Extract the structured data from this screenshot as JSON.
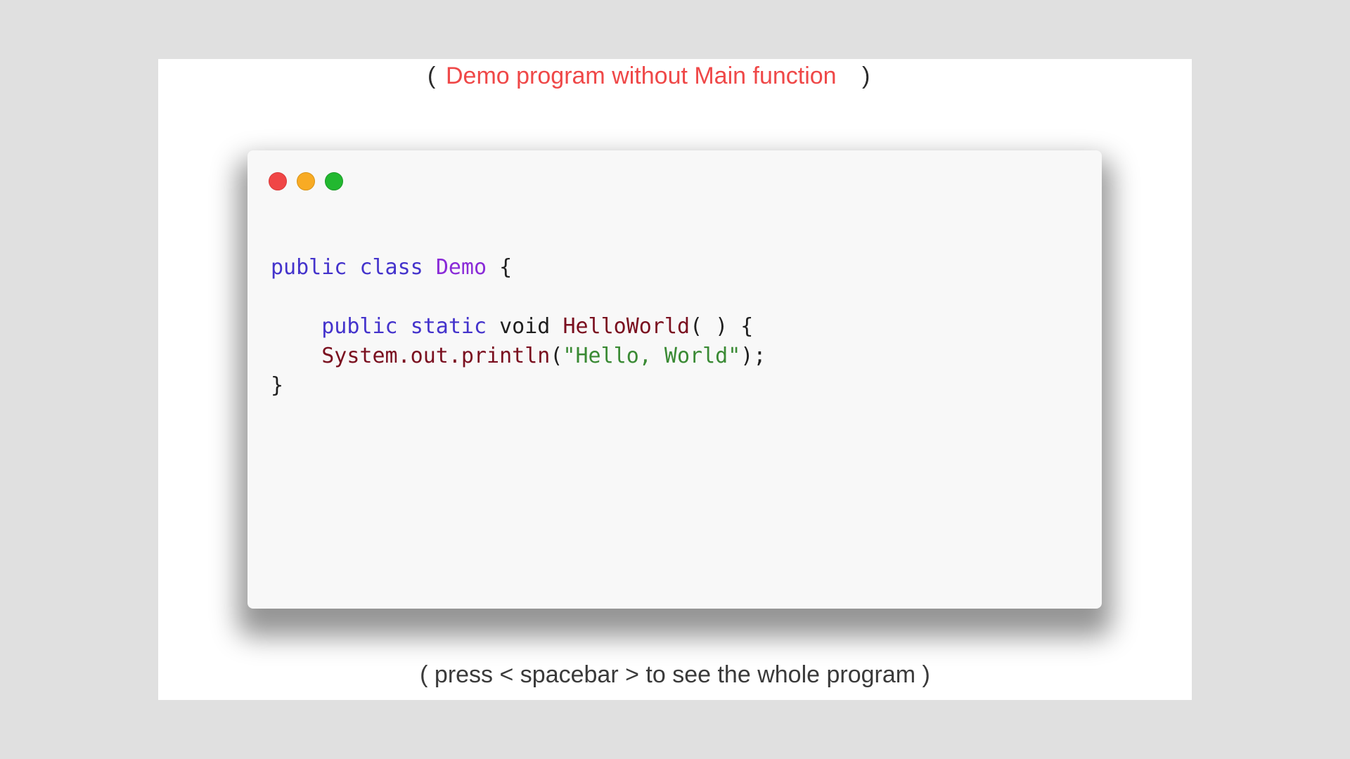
{
  "slide": {
    "title_open": "(",
    "title": "Demo program without Main function",
    "title_close": ")",
    "footer": "( press < spacebar > to see the whole program )"
  },
  "window": {
    "buttons": [
      "close",
      "minimize",
      "maximize"
    ],
    "colors": {
      "close": "#f04646",
      "minimize": "#f8ab24",
      "maximize": "#22b830"
    }
  },
  "code": {
    "line1": {
      "kw1": "public",
      "kw2": "class",
      "cls": "Demo",
      "brace": "{"
    },
    "line3": {
      "indent": "    ",
      "kw1": "public",
      "kw2": "static",
      "ret": "void",
      "fn": "HelloWorld",
      "paren": "( ) {"
    },
    "line4": {
      "indent": "    ",
      "call": "System.out.println",
      "open": "(",
      "str": "\"Hello, World\"",
      "close": ");"
    },
    "line5": {
      "brace": "}"
    }
  },
  "colors": {
    "keyword": "#4433cc",
    "class_name": "#8a2bd8",
    "function": "#7a0f1f",
    "string": "#3a8a34",
    "title": "#ef4848"
  }
}
